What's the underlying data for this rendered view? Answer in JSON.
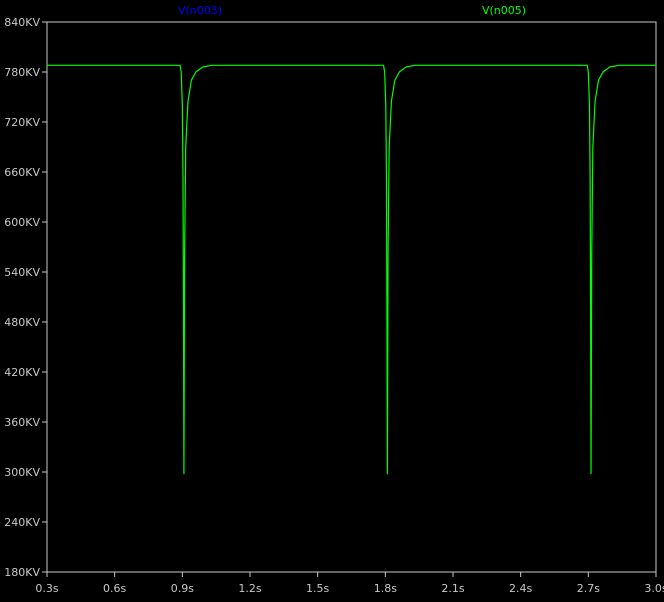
{
  "chart_data": {
    "type": "line",
    "xlim": [
      0.3,
      3.0
    ],
    "ylim": [
      180,
      840
    ],
    "x_ticks": [
      "0.3s",
      "0.6s",
      "0.9s",
      "1.2s",
      "1.5s",
      "1.8s",
      "2.1s",
      "2.4s",
      "2.7s",
      "3.0s"
    ],
    "y_ticks": [
      "840KV",
      "780KV",
      "720KV",
      "660KV",
      "600KV",
      "540KV",
      "480KV",
      "420KV",
      "360KV",
      "300KV",
      "240KV",
      "180KV"
    ],
    "x_tick_values": [
      0.3,
      0.6,
      0.9,
      1.2,
      1.5,
      1.8,
      2.1,
      2.4,
      2.7,
      3.0
    ],
    "y_tick_values": [
      840,
      780,
      720,
      660,
      600,
      540,
      480,
      420,
      360,
      300,
      240,
      180
    ],
    "grid": false,
    "legend_placement": "top",
    "series": [
      {
        "name": "V(n003)",
        "color": "#0000ff",
        "points": []
      },
      {
        "name": "V(n005)",
        "color": "#00ff00",
        "points": [
          [
            0.3,
            788
          ],
          [
            0.89,
            788
          ],
          [
            0.895,
            780
          ],
          [
            0.9,
            740
          ],
          [
            0.903,
            650
          ],
          [
            0.905,
            500
          ],
          [
            0.906,
            400
          ],
          [
            0.907,
            298
          ],
          [
            0.908,
            380
          ],
          [
            0.91,
            560
          ],
          [
            0.915,
            690
          ],
          [
            0.925,
            745
          ],
          [
            0.94,
            770
          ],
          [
            0.96,
            780
          ],
          [
            0.99,
            786
          ],
          [
            1.03,
            788
          ],
          [
            1.792,
            788
          ],
          [
            1.797,
            780
          ],
          [
            1.802,
            740
          ],
          [
            1.805,
            650
          ],
          [
            1.807,
            500
          ],
          [
            1.808,
            400
          ],
          [
            1.809,
            298
          ],
          [
            1.81,
            380
          ],
          [
            1.812,
            560
          ],
          [
            1.817,
            690
          ],
          [
            1.827,
            745
          ],
          [
            1.842,
            770
          ],
          [
            1.862,
            780
          ],
          [
            1.892,
            786
          ],
          [
            1.932,
            788
          ],
          [
            2.695,
            788
          ],
          [
            2.7,
            780
          ],
          [
            2.705,
            740
          ],
          [
            2.708,
            650
          ],
          [
            2.71,
            500
          ],
          [
            2.711,
            400
          ],
          [
            2.712,
            298
          ],
          [
            2.713,
            380
          ],
          [
            2.715,
            560
          ],
          [
            2.72,
            690
          ],
          [
            2.73,
            745
          ],
          [
            2.745,
            770
          ],
          [
            2.765,
            780
          ],
          [
            2.795,
            786
          ],
          [
            2.835,
            788
          ],
          [
            3.0,
            788
          ]
        ]
      }
    ]
  }
}
